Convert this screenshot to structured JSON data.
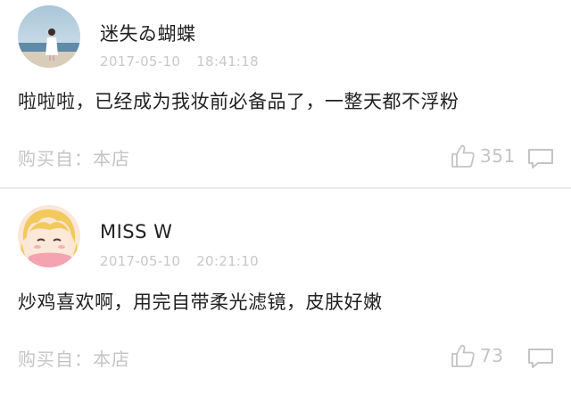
{
  "reviews": [
    {
      "username": "迷失ゐ蝴蝶",
      "date": "2017-05-10",
      "time": "18:41:18",
      "content": "啦啦啦，已经成为我妆前必备品了，一整天都不浮粉",
      "source_label": "购买自：本店",
      "likes": "351",
      "avatar_icon": "girl-by-sea-avatar",
      "like_icon": "thumbs-up-icon",
      "comment_icon": "comment-bubble-icon"
    },
    {
      "username": "MISS W",
      "date": "2017-05-10",
      "time": "20:21:10",
      "content": "炒鸡喜欢啊，用完自带柔光滤镜，皮肤好嫩",
      "source_label": "购买自：本店",
      "likes": "73",
      "avatar_icon": "anime-girl-avatar",
      "like_icon": "thumbs-up-icon",
      "comment_icon": "comment-bubble-icon"
    }
  ],
  "colors": {
    "text_primary": "#222222",
    "text_muted": "#c4c4c4",
    "divider": "#ececec"
  }
}
